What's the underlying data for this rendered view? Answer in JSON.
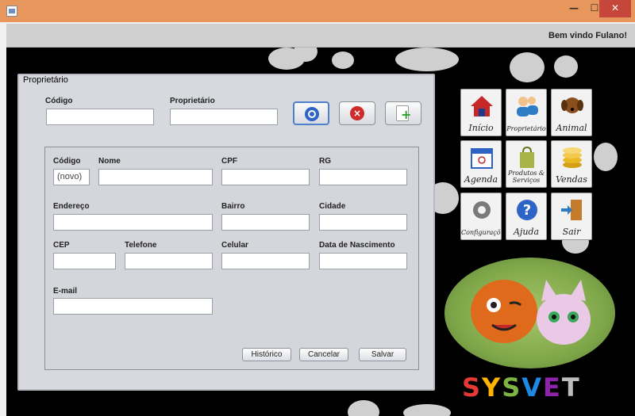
{
  "window": {
    "min": "—",
    "max": "☐",
    "close": "✕"
  },
  "header": {
    "welcome": "Bem vindo Fulano!"
  },
  "form": {
    "title": "Proprietário",
    "search": {
      "codigo_label": "Código",
      "proprietario_label": "Proprietário",
      "codigo_value": "",
      "proprietario_value": ""
    },
    "fields": {
      "codigo_label": "Código",
      "codigo_value": "(novo)",
      "nome_label": "Nome",
      "cpf_label": "CPF",
      "rg_label": "RG",
      "endereco_label": "Endereço",
      "bairro_label": "Bairro",
      "cidade_label": "Cidade",
      "cep_label": "CEP",
      "telefone_label": "Telefone",
      "celular_label": "Celular",
      "nascimento_label": "Data de Nascimento",
      "email_label": "E-mail"
    },
    "buttons": {
      "historico": "Histórico",
      "cancelar": "Cancelar",
      "salvar": "Salvar"
    }
  },
  "menu": {
    "inicio": "Início",
    "proprietario": "Proprietário",
    "animal": "Animal",
    "agenda": "Agenda",
    "produtos": "Produtos & Serviços",
    "vendas": "Vendas",
    "configuracoes": "Configurações",
    "ajuda": "Ajuda",
    "sair": "Sair"
  },
  "logo": {
    "letters": [
      "S",
      "Y",
      "S",
      "V",
      "E",
      "T"
    ],
    "colors": [
      "#e53935",
      "#ffb300",
      "#7cb342",
      "#1e88e5",
      "#8e24aa",
      "#bdbdbd"
    ]
  }
}
